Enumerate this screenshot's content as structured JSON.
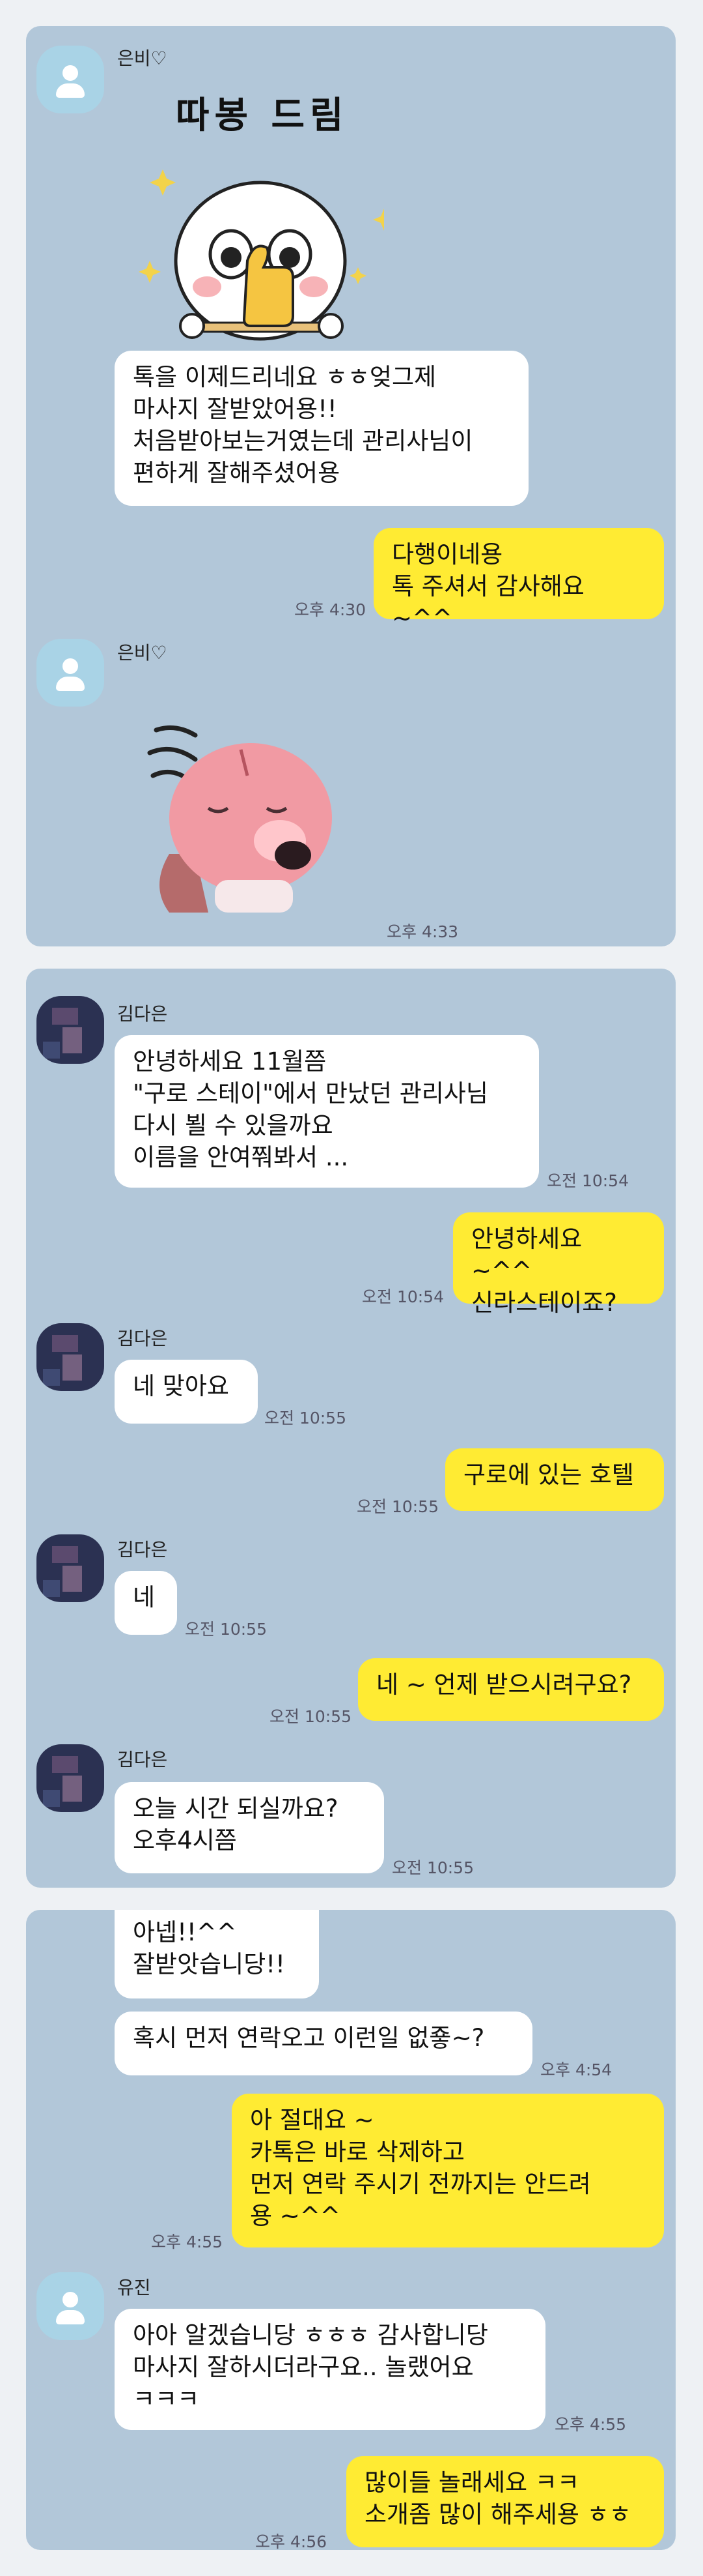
{
  "panel1": {
    "sender_name": "은비♡",
    "sticker1_caption": "따봉 드림",
    "msg1": "톡을 이제드리네요 ㅎㅎ엊그제\n마사지 잘받았어용!!\n처음받아보는거였는데 관리사님이\n편하게 잘해주셨어용",
    "reply1": "다행이네용\n톡 주셔서 감사해요 ~^^",
    "reply1_time": "오후 4:30",
    "sender_name2": "은비♡",
    "sticker2_time": "오후 4:33"
  },
  "panel2": {
    "sender_name": "김다은",
    "m1": "안녕하세요 11월쯤\n\"구로 스테이\"에서 만났던 관리사님\n다시 뵐 수 있을까요\n이름을 안여쭤봐서 ...",
    "m1_time": "오전 10:54",
    "r1": "안녕하세요 ~^^\n신라스테이죠?",
    "r1_time": "오전 10:54",
    "m2": "네 맞아요",
    "m2_time": "오전 10:55",
    "r2": "구로에 있는 호텔",
    "r2_time": "오전 10:55",
    "m3": "네",
    "m3_time": "오전 10:55",
    "r3": "네 ~ 언제 받으시려구요?",
    "r3_time": "오전 10:55",
    "m4": "오늘  시간 되실까요?\n오후4시쯤",
    "m4_time": "오전 10:55"
  },
  "panel3": {
    "m1": "아넵!!^^\n잘받앗습니당!!",
    "m2": "혹시 먼저 연락오고 이런일 없죻~?",
    "m2_time": "오후 4:54",
    "r1": "아 절대요 ~\n카톡은 바로 삭제하고\n먼저 연락 주시기 전까지는 안드려\n용 ~^^",
    "r1_time": "오후 4:55",
    "sender_name": "유진",
    "m3": "아아 알겠습니당 ㅎㅎㅎ 감사합니당\n마사지 잘하시더라구요.. 놀랬어요\nㅋㅋㅋ",
    "m3_time": "오후 4:55",
    "r2": "많이들 놀래세요 ㅋㅋ\n소개좀 많이 해주세용 ㅎㅎ",
    "r2_time": "오후 4:56"
  }
}
